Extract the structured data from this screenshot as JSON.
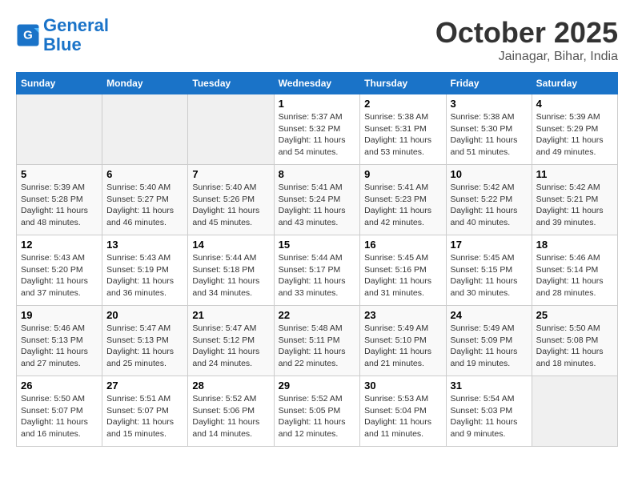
{
  "header": {
    "logo_line1": "General",
    "logo_line2": "Blue",
    "month": "October 2025",
    "location": "Jainagar, Bihar, India"
  },
  "weekdays": [
    "Sunday",
    "Monday",
    "Tuesday",
    "Wednesday",
    "Thursday",
    "Friday",
    "Saturday"
  ],
  "weeks": [
    [
      {
        "day": "",
        "info": ""
      },
      {
        "day": "",
        "info": ""
      },
      {
        "day": "",
        "info": ""
      },
      {
        "day": "1",
        "info": "Sunrise: 5:37 AM\nSunset: 5:32 PM\nDaylight: 11 hours\nand 54 minutes."
      },
      {
        "day": "2",
        "info": "Sunrise: 5:38 AM\nSunset: 5:31 PM\nDaylight: 11 hours\nand 53 minutes."
      },
      {
        "day": "3",
        "info": "Sunrise: 5:38 AM\nSunset: 5:30 PM\nDaylight: 11 hours\nand 51 minutes."
      },
      {
        "day": "4",
        "info": "Sunrise: 5:39 AM\nSunset: 5:29 PM\nDaylight: 11 hours\nand 49 minutes."
      }
    ],
    [
      {
        "day": "5",
        "info": "Sunrise: 5:39 AM\nSunset: 5:28 PM\nDaylight: 11 hours\nand 48 minutes."
      },
      {
        "day": "6",
        "info": "Sunrise: 5:40 AM\nSunset: 5:27 PM\nDaylight: 11 hours\nand 46 minutes."
      },
      {
        "day": "7",
        "info": "Sunrise: 5:40 AM\nSunset: 5:26 PM\nDaylight: 11 hours\nand 45 minutes."
      },
      {
        "day": "8",
        "info": "Sunrise: 5:41 AM\nSunset: 5:24 PM\nDaylight: 11 hours\nand 43 minutes."
      },
      {
        "day": "9",
        "info": "Sunrise: 5:41 AM\nSunset: 5:23 PM\nDaylight: 11 hours\nand 42 minutes."
      },
      {
        "day": "10",
        "info": "Sunrise: 5:42 AM\nSunset: 5:22 PM\nDaylight: 11 hours\nand 40 minutes."
      },
      {
        "day": "11",
        "info": "Sunrise: 5:42 AM\nSunset: 5:21 PM\nDaylight: 11 hours\nand 39 minutes."
      }
    ],
    [
      {
        "day": "12",
        "info": "Sunrise: 5:43 AM\nSunset: 5:20 PM\nDaylight: 11 hours\nand 37 minutes."
      },
      {
        "day": "13",
        "info": "Sunrise: 5:43 AM\nSunset: 5:19 PM\nDaylight: 11 hours\nand 36 minutes."
      },
      {
        "day": "14",
        "info": "Sunrise: 5:44 AM\nSunset: 5:18 PM\nDaylight: 11 hours\nand 34 minutes."
      },
      {
        "day": "15",
        "info": "Sunrise: 5:44 AM\nSunset: 5:17 PM\nDaylight: 11 hours\nand 33 minutes."
      },
      {
        "day": "16",
        "info": "Sunrise: 5:45 AM\nSunset: 5:16 PM\nDaylight: 11 hours\nand 31 minutes."
      },
      {
        "day": "17",
        "info": "Sunrise: 5:45 AM\nSunset: 5:15 PM\nDaylight: 11 hours\nand 30 minutes."
      },
      {
        "day": "18",
        "info": "Sunrise: 5:46 AM\nSunset: 5:14 PM\nDaylight: 11 hours\nand 28 minutes."
      }
    ],
    [
      {
        "day": "19",
        "info": "Sunrise: 5:46 AM\nSunset: 5:13 PM\nDaylight: 11 hours\nand 27 minutes."
      },
      {
        "day": "20",
        "info": "Sunrise: 5:47 AM\nSunset: 5:13 PM\nDaylight: 11 hours\nand 25 minutes."
      },
      {
        "day": "21",
        "info": "Sunrise: 5:47 AM\nSunset: 5:12 PM\nDaylight: 11 hours\nand 24 minutes."
      },
      {
        "day": "22",
        "info": "Sunrise: 5:48 AM\nSunset: 5:11 PM\nDaylight: 11 hours\nand 22 minutes."
      },
      {
        "day": "23",
        "info": "Sunrise: 5:49 AM\nSunset: 5:10 PM\nDaylight: 11 hours\nand 21 minutes."
      },
      {
        "day": "24",
        "info": "Sunrise: 5:49 AM\nSunset: 5:09 PM\nDaylight: 11 hours\nand 19 minutes."
      },
      {
        "day": "25",
        "info": "Sunrise: 5:50 AM\nSunset: 5:08 PM\nDaylight: 11 hours\nand 18 minutes."
      }
    ],
    [
      {
        "day": "26",
        "info": "Sunrise: 5:50 AM\nSunset: 5:07 PM\nDaylight: 11 hours\nand 16 minutes."
      },
      {
        "day": "27",
        "info": "Sunrise: 5:51 AM\nSunset: 5:07 PM\nDaylight: 11 hours\nand 15 minutes."
      },
      {
        "day": "28",
        "info": "Sunrise: 5:52 AM\nSunset: 5:06 PM\nDaylight: 11 hours\nand 14 minutes."
      },
      {
        "day": "29",
        "info": "Sunrise: 5:52 AM\nSunset: 5:05 PM\nDaylight: 11 hours\nand 12 minutes."
      },
      {
        "day": "30",
        "info": "Sunrise: 5:53 AM\nSunset: 5:04 PM\nDaylight: 11 hours\nand 11 minutes."
      },
      {
        "day": "31",
        "info": "Sunrise: 5:54 AM\nSunset: 5:03 PM\nDaylight: 11 hours\nand 9 minutes."
      },
      {
        "day": "",
        "info": ""
      }
    ]
  ]
}
